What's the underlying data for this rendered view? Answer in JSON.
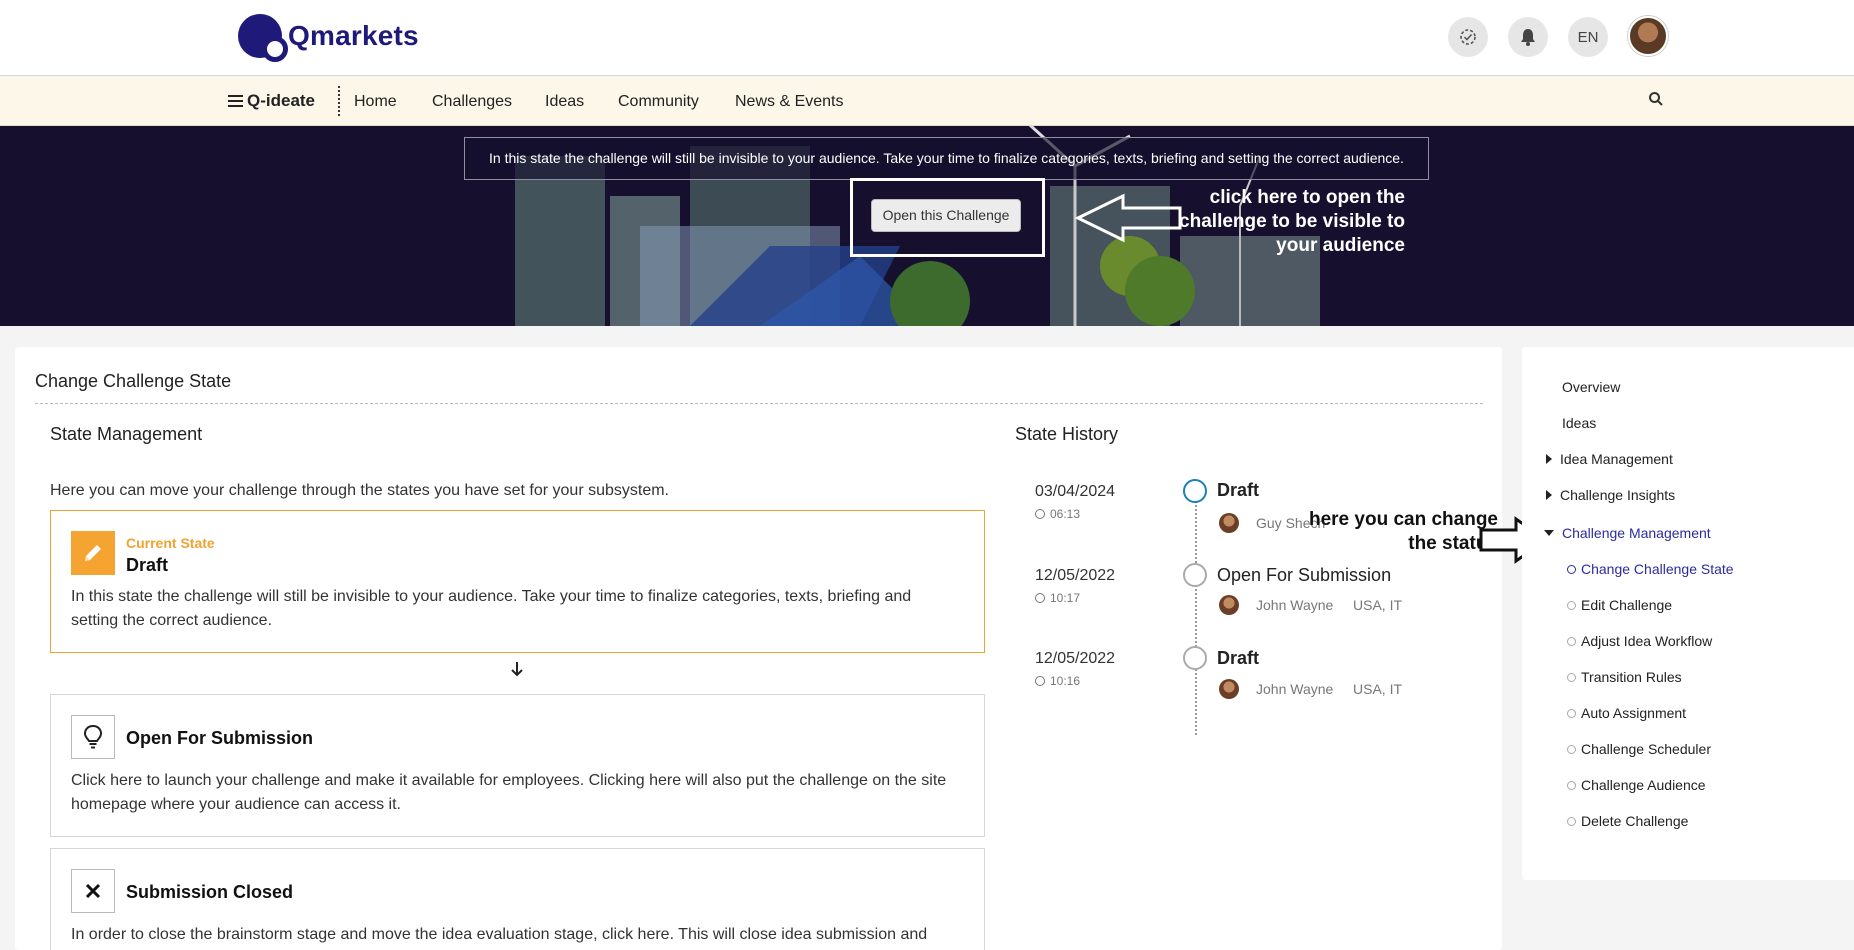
{
  "header": {
    "brand": "Qmarkets",
    "icons": [
      "progress-check-icon",
      "bell-icon",
      "language-toggle",
      "user-avatar"
    ],
    "language": "EN"
  },
  "nav": {
    "menu_label": "Q-ideate",
    "links": [
      "Home",
      "Challenges",
      "Ideas",
      "Community",
      "News & Events"
    ]
  },
  "banner": {
    "message": "In this state the challenge will still be invisible to your audience. Take your time to finalize categories, texts, briefing and setting the correct audience.",
    "open_button": "Open this Challenge",
    "annotation": "click here to open the challenge to be visible to your audience"
  },
  "main": {
    "title": "Change Challenge State",
    "state_management": {
      "title": "State Management",
      "intro": "Here you can move your challenge through the states you have set for your subsystem.",
      "current_label": "Current State",
      "states": [
        {
          "name": "Draft",
          "icon": "pencil-icon",
          "description": "In this state the challenge will still be invisible to your audience. Take your time to finalize categories, texts, briefing and setting the correct audience."
        },
        {
          "name": "Open For Submission",
          "icon": "lightbulb-icon",
          "description": "Click here to launch your challenge and make it available for employees. Clicking here will also put the challenge on the site homepage where your audience can access it."
        },
        {
          "name": "Submission Closed",
          "icon": "close-icon",
          "description": "In order to close the brainstorm stage and move the idea evaluation stage, click here. This will close idea submission and"
        }
      ]
    },
    "state_history": {
      "title": "State History",
      "annotation": "here you can change the status",
      "entries": [
        {
          "date": "03/04/2024",
          "time": "06:13",
          "state": "Draft",
          "user": "Guy Shech",
          "location": ""
        },
        {
          "date": "12/05/2022",
          "time": "10:17",
          "state": "Open For Submission",
          "user": "John Wayne",
          "location": "USA, IT"
        },
        {
          "date": "12/05/2022",
          "time": "10:16",
          "state": "Draft",
          "user": "John Wayne",
          "location": "USA, IT"
        }
      ]
    }
  },
  "sidebar": {
    "items": [
      "Overview",
      "Ideas",
      "Idea Management",
      "Challenge Insights",
      "Challenge Management"
    ],
    "sub_items": [
      "Change Challenge State",
      "Edit Challenge",
      "Adjust Idea Workflow",
      "Transition Rules",
      "Auto Assignment",
      "Challenge Scheduler",
      "Challenge Audience",
      "Delete Challenge"
    ]
  },
  "colors": {
    "brand": "#1f1a7a",
    "accent": "#f0a232",
    "active_link": "#2b2ba0",
    "timeline_active": "#1b7fb8"
  }
}
